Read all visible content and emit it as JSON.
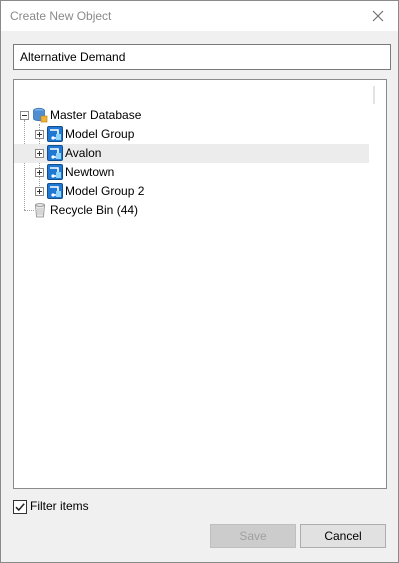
{
  "window": {
    "title": "Create New Object",
    "close_icon": "close-icon"
  },
  "name_field": {
    "value": "Alternative Demand"
  },
  "tree": {
    "root": {
      "label": "Master Database",
      "icon": "database-icon",
      "expanded": true
    },
    "children": [
      {
        "label": "Model Group",
        "icon": "model-group-icon",
        "expanded": false,
        "selected": false
      },
      {
        "label": "Avalon",
        "icon": "model-group-icon",
        "expanded": false,
        "selected": true
      },
      {
        "label": "Newtown",
        "icon": "model-group-icon",
        "expanded": false,
        "selected": false
      },
      {
        "label": "Model Group 2",
        "icon": "model-group-icon",
        "expanded": false,
        "selected": false
      }
    ],
    "recycle_bin": {
      "label": "Recycle Bin (44)",
      "icon": "recycle-bin-icon"
    }
  },
  "filter": {
    "label": "Filter items",
    "checked": true
  },
  "buttons": {
    "save": {
      "label": "Save",
      "enabled": false
    },
    "cancel": {
      "label": "Cancel",
      "enabled": true
    }
  }
}
